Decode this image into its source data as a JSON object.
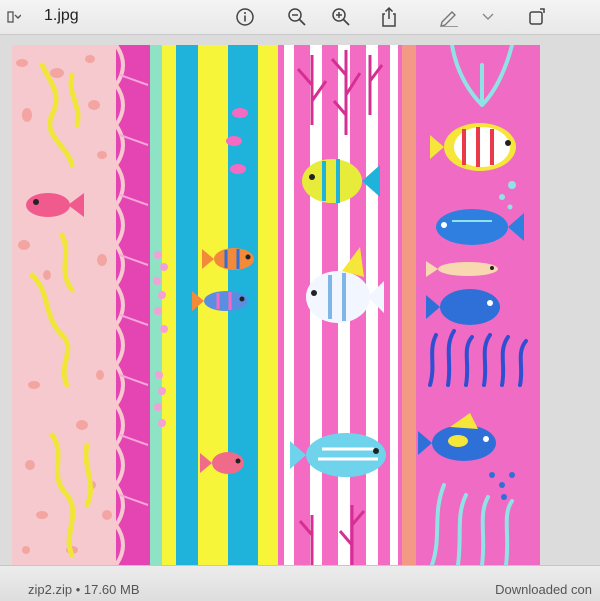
{
  "window": {
    "filename": "1.jpg",
    "icons": [
      "sidebar-chevron-icon",
      "info-icon",
      "zoom-out-icon",
      "zoom-in-icon",
      "share-icon",
      "markup-pen-icon",
      "markup-chevron-icon",
      "rotate-crop-icon"
    ]
  },
  "image": {
    "description_colors": {
      "pink_light": "#f6c8cf",
      "magenta": "#e845b8",
      "hot_pink": "#f46bc4",
      "cyan": "#1fb3dc",
      "yellow": "#f7f53a",
      "mint": "#8fe3c5",
      "salmon": "#f39a86",
      "blue": "#2f6fd8"
    }
  },
  "footer": {
    "left_text": "zip2.zip • 17.60 MB",
    "right_text": "Downloaded con"
  }
}
